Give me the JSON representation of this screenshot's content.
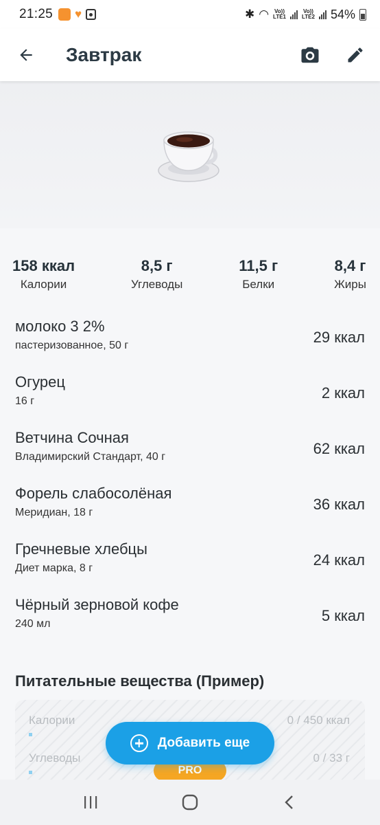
{
  "status": {
    "time": "21:25",
    "battery": "54%",
    "sim1": "LTE1",
    "sim2": "LTE2",
    "volte": "Vo))"
  },
  "appbar": {
    "title": "Завтрак"
  },
  "macros": [
    {
      "value": "158 ккал",
      "label": "Калории"
    },
    {
      "value": "8,5 г",
      "label": "Углеводы"
    },
    {
      "value": "11,5 г",
      "label": "Белки"
    },
    {
      "value": "8,4 г",
      "label": "Жиры"
    }
  ],
  "foods": [
    {
      "name": "молоко 3 2%",
      "detail": "пастеризованное, 50 г",
      "kcal": "29 ккал"
    },
    {
      "name": "Огурец",
      "detail": "16 г",
      "kcal": "2 ккал"
    },
    {
      "name": "Ветчина Сочная",
      "detail": "Владимирский Стандарт, 40 г",
      "kcal": "62 ккал"
    },
    {
      "name": "Форель слабосолёная",
      "detail": "Меридиан, 18 г",
      "kcal": "36 ккал"
    },
    {
      "name": "Гречневые хлебцы",
      "detail": "Диет марка, 8 г",
      "kcal": "24 ккал"
    },
    {
      "name": "Чёрный зерновой кофе",
      "detail": "240 мл",
      "kcal": "5 ккал"
    }
  ],
  "nutrients": {
    "title": "Питательные вещества (Пример)",
    "rows": [
      {
        "label": "Калории",
        "value": "0 / 450 ккал"
      },
      {
        "label": "Углеводы",
        "value": "0 / 33 г"
      }
    ],
    "badge": "PRO"
  },
  "fab": {
    "label": "Добавить еще"
  },
  "colors": {
    "accent": "#1ba0e6",
    "pro": "#f5a623",
    "title": "#2c3a44"
  }
}
